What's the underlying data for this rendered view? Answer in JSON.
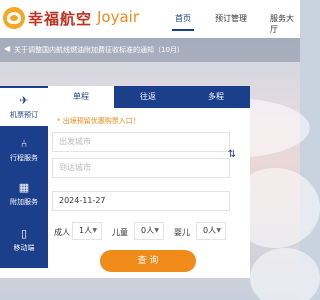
{
  "header": {
    "brand_cn": "幸福航空",
    "brand_en": "Joyair",
    "nav": [
      {
        "label": "首页",
        "active": true
      },
      {
        "label": "预订管理",
        "active": false
      },
      {
        "label": "服务大厅",
        "active": false
      }
    ]
  },
  "notice": {
    "text": "关于调整国内航线燃油附加费征收标准的通知（10月）"
  },
  "sidebar": {
    "items": [
      {
        "label": "机票预订",
        "icon": "plane-icon",
        "active": true
      },
      {
        "label": "行程服务",
        "icon": "seat-icon",
        "active": false
      },
      {
        "label": "附加服务",
        "icon": "luggage-icon",
        "active": false
      },
      {
        "label": "移动端",
        "icon": "mobile-icon",
        "active": false
      }
    ]
  },
  "tabs": [
    {
      "label": "单程",
      "active": true
    },
    {
      "label": "往返",
      "active": false
    },
    {
      "label": "多程",
      "active": false
    }
  ],
  "form": {
    "hint": "* 出境预留优惠购票入口！",
    "from_placeholder": "出发城市",
    "to_placeholder": "到达城市",
    "date_value": "2024-11-27",
    "passengers": {
      "adult_label": "成人",
      "adult_value": "1人",
      "child_label": "儿童",
      "child_value": "0人",
      "infant_label": "婴儿",
      "infant_value": "0人"
    },
    "search_label": "查 询"
  },
  "colors": {
    "primary": "#1c3f8c",
    "accent": "#f08a1a",
    "brand_red": "#c0311f"
  }
}
